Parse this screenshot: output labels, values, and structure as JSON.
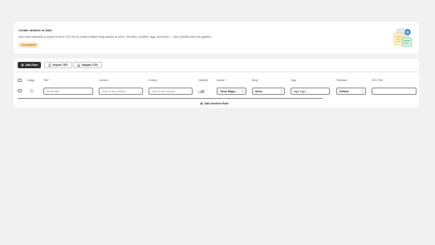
{
  "intro": {
    "title": "Create articles in bulk",
    "description": "Add rows manually or import from a CSV file to create multiple blog articles at once. Set titles, content, tags, and more — then publish them all together.",
    "badge": "1 incomplete"
  },
  "toolbar": {
    "add_row": "Add Row",
    "import_csv": "Import CSV",
    "sample_csv": "Sample CSV"
  },
  "table": {
    "headers": {
      "image": "Image",
      "title": "Title",
      "content": "Content",
      "excerpt": "Excerpt",
      "visibility": "Visibility",
      "author": "Author",
      "blog": "Blog",
      "tags": "Tags",
      "template": "Template",
      "seo_title": "SEO Title"
    },
    "required_mark": "*",
    "row": {
      "title_placeholder": "Article title...",
      "content_placeholder": "Click to edit content...",
      "excerpt_placeholder": "Click to edit excerpt...",
      "visibility_on": false,
      "author": "Tarun Rajpu...",
      "blog": "News",
      "tags": "tag1, tag2,...",
      "template": "Default",
      "seo_title": ""
    }
  },
  "footer": {
    "add_another_row": "Add Another Row"
  },
  "icons": {
    "add": "plus-icon",
    "import": "upload-icon",
    "sample": "download-icon",
    "image": "image-placeholder-icon",
    "chevron": "chevron-updown-icon",
    "illustration": "bulk-documents-illustration"
  }
}
